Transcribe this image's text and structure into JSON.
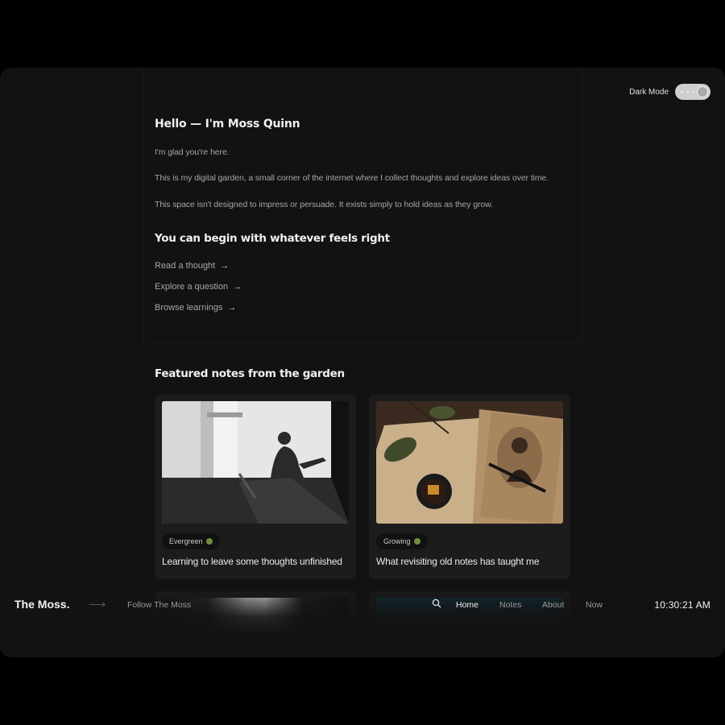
{
  "dark_mode": {
    "label": "Dark Mode"
  },
  "intro": {
    "heading": "Hello — I'm Moss Quinn",
    "paragraphs": [
      "I'm glad you're here.",
      "This is my digital garden, a small corner of the internet where I collect thoughts and explore ideas over time.",
      "This space isn't designed to impress or persuade. It exists simply to hold ideas as they grow."
    ]
  },
  "begin": {
    "heading": "You can begin with whatever feels right",
    "links": [
      {
        "label": "Read a thought",
        "icon": "arrow-right-icon"
      },
      {
        "label": "Explore a question",
        "icon": "arrow-right-icon"
      },
      {
        "label": "Browse learnings",
        "icon": "arrow-right-icon"
      }
    ]
  },
  "featured": {
    "heading": "Featured notes from the garden",
    "cards": [
      {
        "badge": "Evergreen",
        "badge_icon": "seedling-icon",
        "title": "Learning to leave some thoughts unfinished"
      },
      {
        "badge": "Growing",
        "badge_icon": "sprout-icon",
        "title": "What revisiting old notes has taught me"
      }
    ]
  },
  "nav": {
    "brand": "The Moss.",
    "follow": "Follow The Moss",
    "items": [
      "Home",
      "Notes",
      "About",
      "Now"
    ],
    "active": "Home",
    "clock": "10:30:21 AM"
  },
  "colors": {
    "background": "#121212",
    "card": "#1c1c1c",
    "text": "#f0f0f0",
    "muted": "#a6a6a6"
  }
}
